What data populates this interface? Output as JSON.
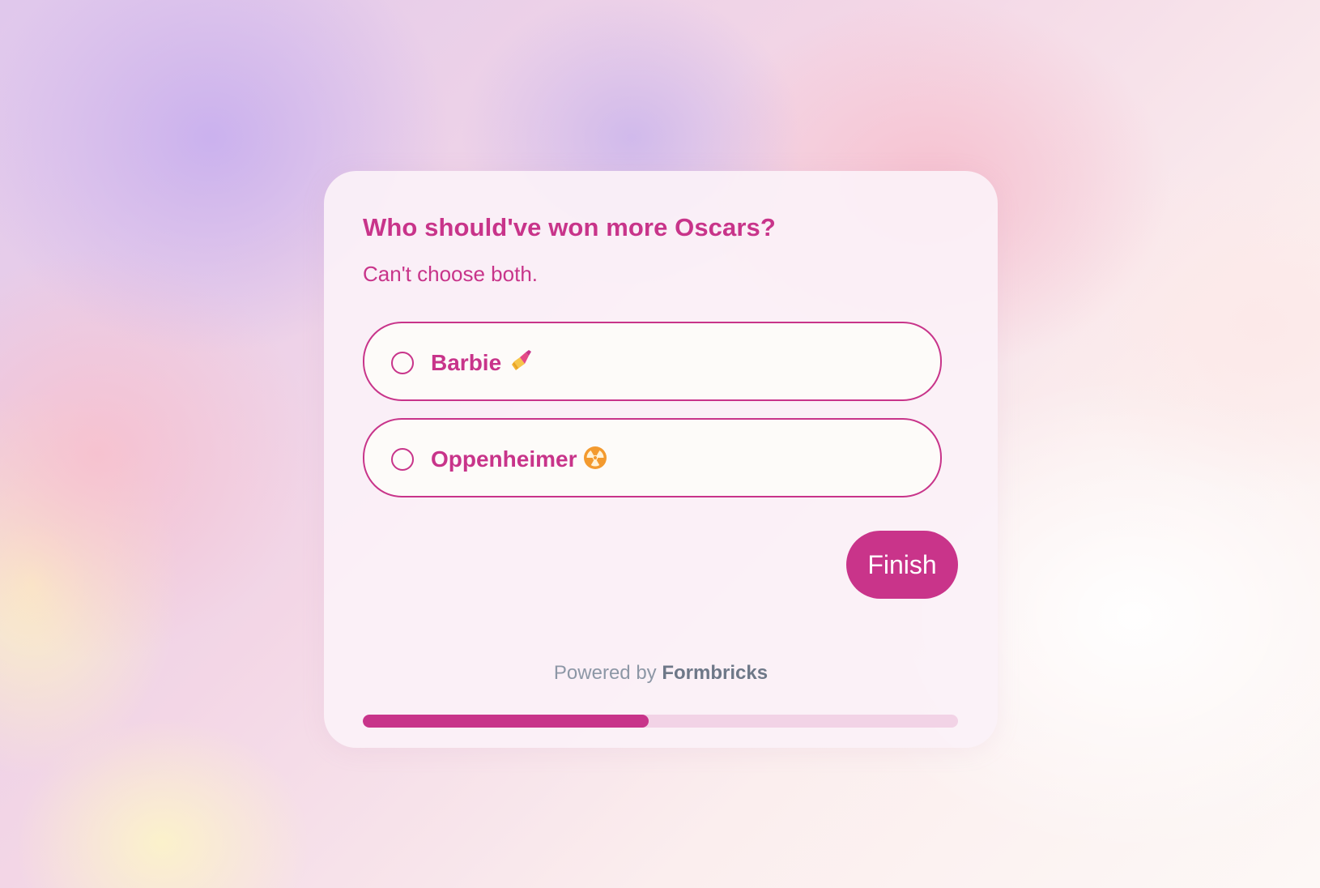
{
  "survey": {
    "question": "Who should've won more Oscars?",
    "subheader": "Can't choose both.",
    "options": [
      {
        "label": "Barbie",
        "icon": "nail-polish-emoji",
        "selected": false
      },
      {
        "label": "Oppenheimer",
        "icon": "radioactive-emoji",
        "selected": false
      }
    ],
    "finish_label": "Finish"
  },
  "footer": {
    "powered_prefix": "Powered by",
    "powered_brand": "Formbricks"
  },
  "progress": {
    "fraction": 0.48
  },
  "colors": {
    "brand": "#c8348a",
    "card_background": "#fbf1f7",
    "option_background": "#fdfbf9",
    "progress_track": "#f2d3e6",
    "footer_text": "#8d97a6"
  }
}
